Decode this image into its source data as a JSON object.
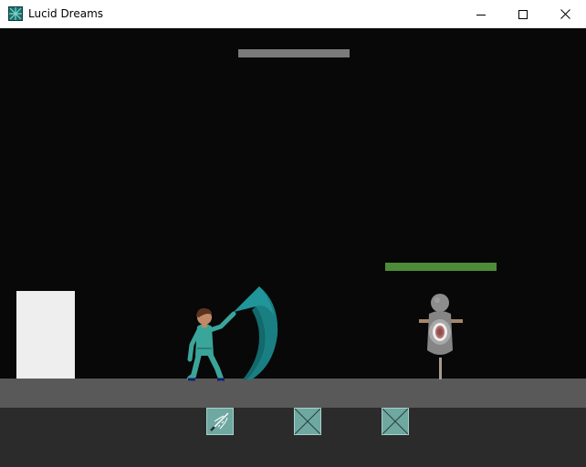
{
  "window": {
    "title": "Lucid Dreams",
    "icon": "app-icon",
    "controls": [
      "minimize-icon",
      "maximize-icon",
      "close-icon"
    ]
  },
  "game": {
    "colors": {
      "background": "#080808",
      "ground": "#595959",
      "hud": "#2b2b2b",
      "platform": "#7a7a7a",
      "white_block": "#eeeeee",
      "player_suit": "#3aa59a",
      "weapon": "#1a7f82",
      "enemy_health": "#4c8c39",
      "dummy": "#8a8a8a",
      "slot": "#6fa8a1"
    },
    "enemy": {
      "name": "training-dummy",
      "health_fraction": 1.0
    },
    "inventory": {
      "slots": [
        {
          "item": "sword-icon",
          "empty": false
        },
        {
          "item": "empty-slot-icon",
          "empty": true
        },
        {
          "item": "empty-slot-icon",
          "empty": true
        }
      ]
    }
  }
}
